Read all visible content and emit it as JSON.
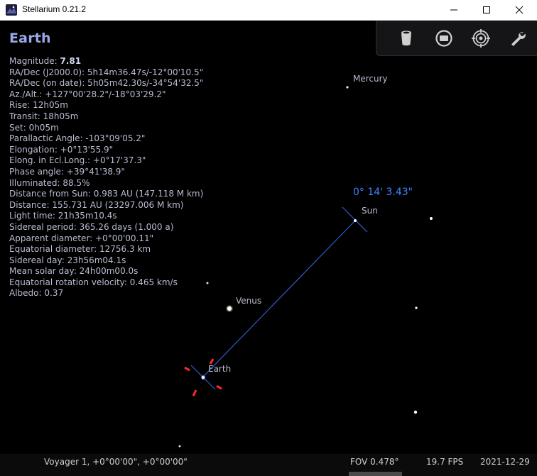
{
  "window": {
    "title": "Stellarium 0.21.2"
  },
  "object": {
    "name": "Earth",
    "magnitude_label": "Magnitude: ",
    "magnitude_value": "7.81",
    "info": [
      "RA/Dec (J2000.0): 5h14m36.47s/-12°00'10.5\"",
      "RA/Dec (on date): 5h05m42.30s/-34°54'32.5\"",
      "Az./Alt.: +127°00'28.2\"/-18°03'29.2\"",
      "Rise: 12h05m",
      "Transit: 18h05m",
      "Set: 0h05m",
      "Parallactic Angle: -103°09'05.2\"",
      "Elongation: +0°13'55.9\"",
      "Elong. in Ecl.Long.: +0°17'37.3\"",
      "Phase angle: +39°41'38.9\"",
      "Illuminated: 88.5%",
      "Distance from Sun: 0.983 AU (147.118 M km)",
      "Distance: 155.731 AU (23297.006 M km)",
      "Light time: 21h35m10.4s",
      "Sidereal period: 365.26 days (1.000 a)",
      "Apparent diameter: +0°00'00.11\"",
      "Equatorial diameter: 12756.3 km",
      "Sidereal day: 23h56m04.1s",
      "Mean solar day: 24h00m00.0s",
      "Equatorial rotation velocity: 0.465 km/s",
      "Albedo: 0.37"
    ]
  },
  "sky_labels": {
    "mercury": "Mercury",
    "sun": "Sun",
    "venus": "Venus",
    "earth": "Earth",
    "angular_distance": "0° 14' 3.43\""
  },
  "tools": [
    "trash-icon",
    "screen-icon",
    "target-icon",
    "wrench-icon"
  ],
  "status": {
    "location": "Voyager 1, +0°00'00\", +0°00'00\"",
    "fov": "FOV 0.478°",
    "fps": "19.7 FPS",
    "date": "2021-12-29"
  },
  "colors": {
    "info_text": "#b9bcd2",
    "title": "#9aa6e8",
    "measure": "#3b84ff",
    "marker": "#ff2a2a"
  }
}
